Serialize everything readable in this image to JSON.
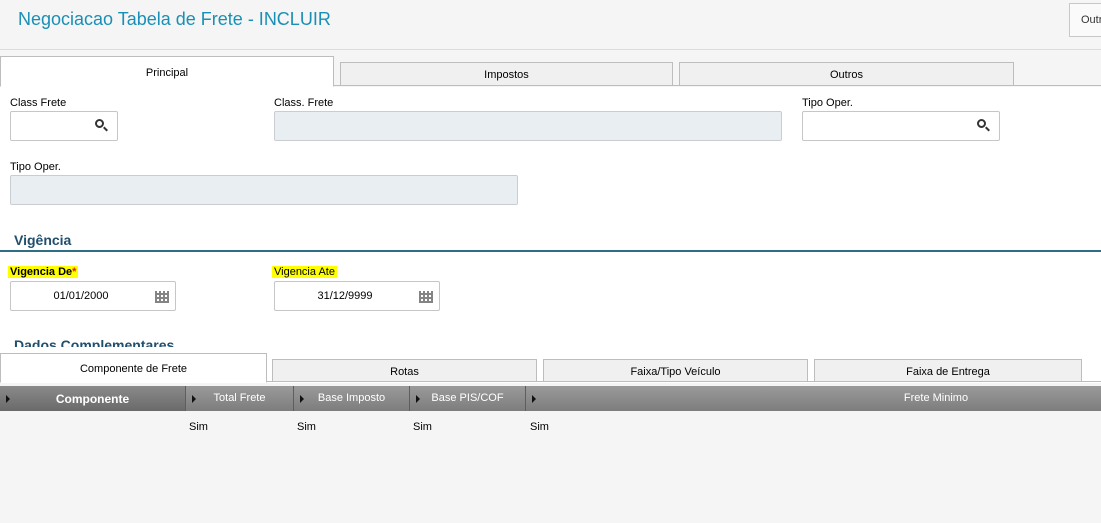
{
  "header": {
    "title": "Negociacao Tabela de Frete - INCLUIR",
    "other_button": "Outr"
  },
  "top_tabs": [
    "Principal",
    "Impostos",
    "Outros"
  ],
  "form": {
    "class_frete_label": "Class Frete",
    "class_frete_value": "",
    "class_frete_desc_label": "Class. Frete",
    "class_frete_desc_value": "",
    "tipo_oper_label": "Tipo Oper.",
    "tipo_oper_value": "",
    "tipo_oper_desc_label": "Tipo Oper.",
    "tipo_oper_desc_value": ""
  },
  "vigencia": {
    "section_title": "Vigência",
    "de_label": "Vigencia De",
    "de_required_mark": "*",
    "de_value": "01/01/2000",
    "ate_label": "Vigencia Ate",
    "ate_value": "31/12/9999"
  },
  "complementares_title": "Dados Complementares",
  "bottom_tabs": [
    "Componente de Frete",
    "Rotas",
    "Faixa/Tipo Veículo",
    "Faixa de Entrega"
  ],
  "grid": {
    "columns": [
      "Componente",
      "Total Frete",
      "Base Imposto",
      "Base PIS/COF",
      "Frete Minimo"
    ],
    "row": [
      "",
      "Sim",
      "Sim",
      "Sim",
      "Sim"
    ]
  },
  "icons": [
    "search-icon",
    "calendar-icon",
    "column-arrow-icon"
  ],
  "colors": {
    "title": "#1a8fb5",
    "section": "#1f4e6e",
    "highlight": "#ffff00",
    "required": "#e01919"
  }
}
